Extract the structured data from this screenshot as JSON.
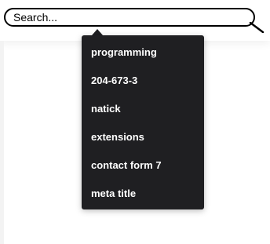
{
  "search": {
    "placeholder": "Search...",
    "value": ""
  },
  "suggestions": [
    "programming",
    "204-673-3",
    "natick",
    "extensions",
    "contact form 7",
    "meta title"
  ],
  "colors": {
    "dropdown_bg": "#1f1f22",
    "dropdown_text": "#ffffff",
    "input_border": "#000000"
  },
  "icons": {
    "search": "search-icon"
  }
}
